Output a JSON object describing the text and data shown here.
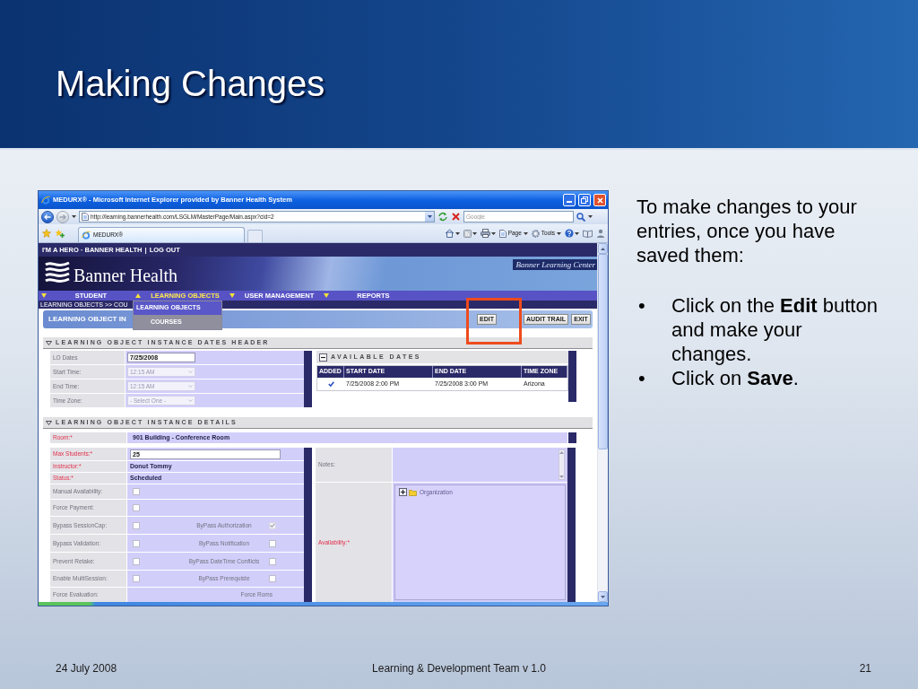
{
  "slide": {
    "title": "Making Changes"
  },
  "browser": {
    "title": "MEDURX® - Microsoft Internet Explorer provided by Banner Health System",
    "address": "http://learning.bannerhealth.com/LSGLM/MasterPage/Main.aspx?cid=2",
    "search": {
      "placeholder": "Google"
    },
    "tab": {
      "label": "MEDURX®"
    },
    "commands": [
      {
        "kind": "page",
        "label": "Page"
      },
      {
        "kind": "tools",
        "label": "Tools"
      }
    ]
  },
  "site": {
    "top_nav": {
      "user": "I'M A HERO · BANNER HEALTH",
      "separator": "|",
      "logout": "LOG OUT"
    },
    "logo": "Banner Health",
    "product": "Banner Learning Center",
    "menu": [
      {
        "label": "STUDENT",
        "expanded": false
      },
      {
        "label": "LEARNING OBJECTS",
        "expanded": true
      },
      {
        "label": "USER MANAGEMENT",
        "expanded": false
      },
      {
        "label": "REPORTS",
        "expanded": false
      }
    ],
    "submenu": [
      {
        "label": "LEARNING OBJECTS",
        "selected": true
      },
      {
        "label": "COURSES",
        "selected": false
      }
    ],
    "breadcrumb": "LEARNING OBJECTS >> COU",
    "page_title": "LEARNING OBJECT IN",
    "actions": [
      {
        "label": "EDIT",
        "highlighted": true
      },
      {
        "label": "AUDIT TRAIL",
        "highlighted": false
      },
      {
        "label": "EXIT",
        "highlighted": false
      }
    ]
  },
  "dates_section": {
    "title": "LEARNING OBJECT INSTANCE DATES HEADER",
    "expanded": true,
    "fields": [
      {
        "label": "LO Dates",
        "kind": "input",
        "value": "7/25/2008",
        "disabled": false
      },
      {
        "label": "Start Time:",
        "kind": "select",
        "value": "12:15 AM",
        "disabled": true
      },
      {
        "label": "End Time:",
        "kind": "select",
        "value": "12:15 AM",
        "disabled": true
      },
      {
        "label": "Time Zone:",
        "kind": "select",
        "value": "- Select One -",
        "disabled": true
      }
    ],
    "available_dates": {
      "title": "AVAILABLE DATES",
      "expanded": true,
      "columns": [
        "ADDED",
        "START DATE",
        "END DATE",
        "TIME ZONE"
      ],
      "rows": [
        {
          "added": true,
          "start": "7/25/2008 2:00 PM",
          "end": "7/25/2008 3:00 PM",
          "zone": "Arizona"
        }
      ]
    }
  },
  "details_section": {
    "title": "LEARNING OBJECT INSTANCE DETAILS",
    "expanded": true,
    "room": {
      "label": "Room:*",
      "required": true,
      "value": "901 Building - Conference Room"
    },
    "fields": [
      {
        "label": "Max Students:*",
        "required": true,
        "kind": "input",
        "value": "25"
      },
      {
        "label": "Instructor:*",
        "required": true,
        "kind": "text",
        "value": "Donut Tommy"
      },
      {
        "label": "Status:*",
        "required": true,
        "kind": "text",
        "value": "Scheduled"
      },
      {
        "label": "Manual Availability:",
        "required": false,
        "kind": "checkbox",
        "checked": false
      },
      {
        "label": "Force Payment:",
        "required": false,
        "kind": "checkbox",
        "checked": false
      },
      {
        "label": "Bypass SessionCap:",
        "required": false,
        "kind": "checkbox",
        "checked": false,
        "extra": {
          "label": "ByPass Authorization",
          "checked": true,
          "disabled": true
        }
      },
      {
        "label": "Bypass Validation:",
        "required": false,
        "kind": "checkbox",
        "checked": false,
        "extra": {
          "label": "ByPass Notification",
          "checked": false,
          "disabled": false
        }
      },
      {
        "label": "Prevent Retake:",
        "required": false,
        "kind": "checkbox",
        "checked": false,
        "extra": {
          "label": "ByPass DateTime Conflicts",
          "checked": false,
          "disabled": false
        }
      },
      {
        "label": "Enable MultiSession:",
        "required": false,
        "kind": "checkbox",
        "checked": false,
        "extra": {
          "label": "ByPass Prerequiste",
          "checked": false,
          "disabled": false
        }
      },
      {
        "label": "Force Evaluation:",
        "required": false,
        "kind": "plain",
        "extra": {
          "label": "Force Roms"
        }
      }
    ],
    "notes": {
      "label": "Notes:",
      "required": false
    },
    "availability": {
      "label": "Availability:*",
      "required": true,
      "tree": [
        {
          "label": "Organization",
          "expanded": false
        }
      ]
    }
  },
  "aside": {
    "intro": "To make changes to your entries, once you have saved them:",
    "bullets": [
      {
        "marker": "•",
        "text": "Click on the **Edit** button and make your changes."
      },
      {
        "marker": "•",
        "text": "Click on **Save**."
      }
    ]
  },
  "footer": {
    "date": "24 July 2008",
    "team": "Learning & Development Team v 1.0",
    "page": "21"
  }
}
